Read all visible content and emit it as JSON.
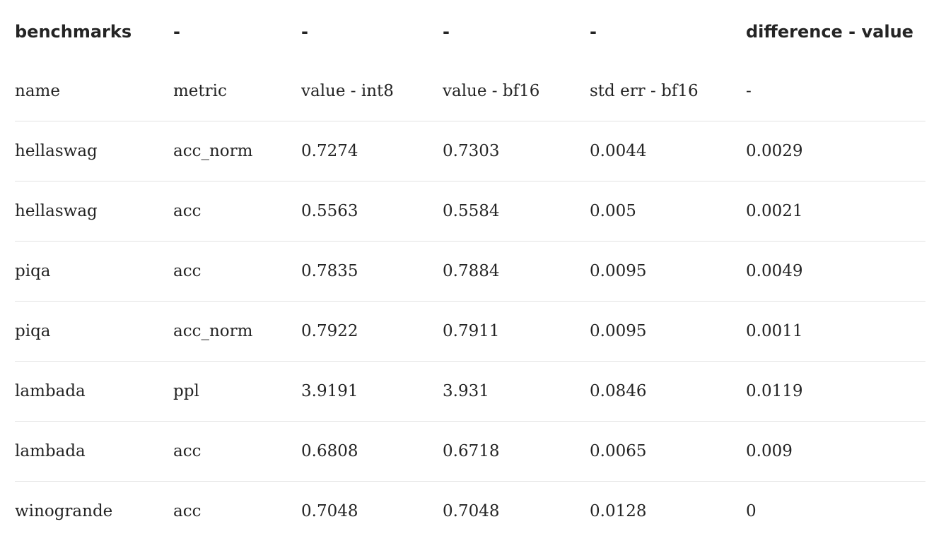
{
  "table": {
    "headers": [
      "benchmarks",
      "-",
      "-",
      "-",
      "-",
      "difference - value"
    ],
    "rows": [
      [
        "name",
        "metric",
        "value - int8",
        "value - bf16",
        "std err - bf16",
        "-"
      ],
      [
        "hellaswag",
        "acc_norm",
        "0.7274",
        "0.7303",
        "0.0044",
        "0.0029"
      ],
      [
        "hellaswag",
        "acc",
        "0.5563",
        "0.5584",
        "0.005",
        "0.0021"
      ],
      [
        "piqa",
        "acc",
        "0.7835",
        "0.7884",
        "0.0095",
        "0.0049"
      ],
      [
        "piqa",
        "acc_norm",
        "0.7922",
        "0.7911",
        "0.0095",
        "0.0011"
      ],
      [
        "lambada",
        "ppl",
        "3.9191",
        "3.931",
        "0.0846",
        "0.0119"
      ],
      [
        "lambada",
        "acc",
        "0.6808",
        "0.6718",
        "0.0065",
        "0.009"
      ],
      [
        "winogrande",
        "acc",
        "0.7048",
        "0.7048",
        "0.0128",
        "0"
      ]
    ]
  }
}
